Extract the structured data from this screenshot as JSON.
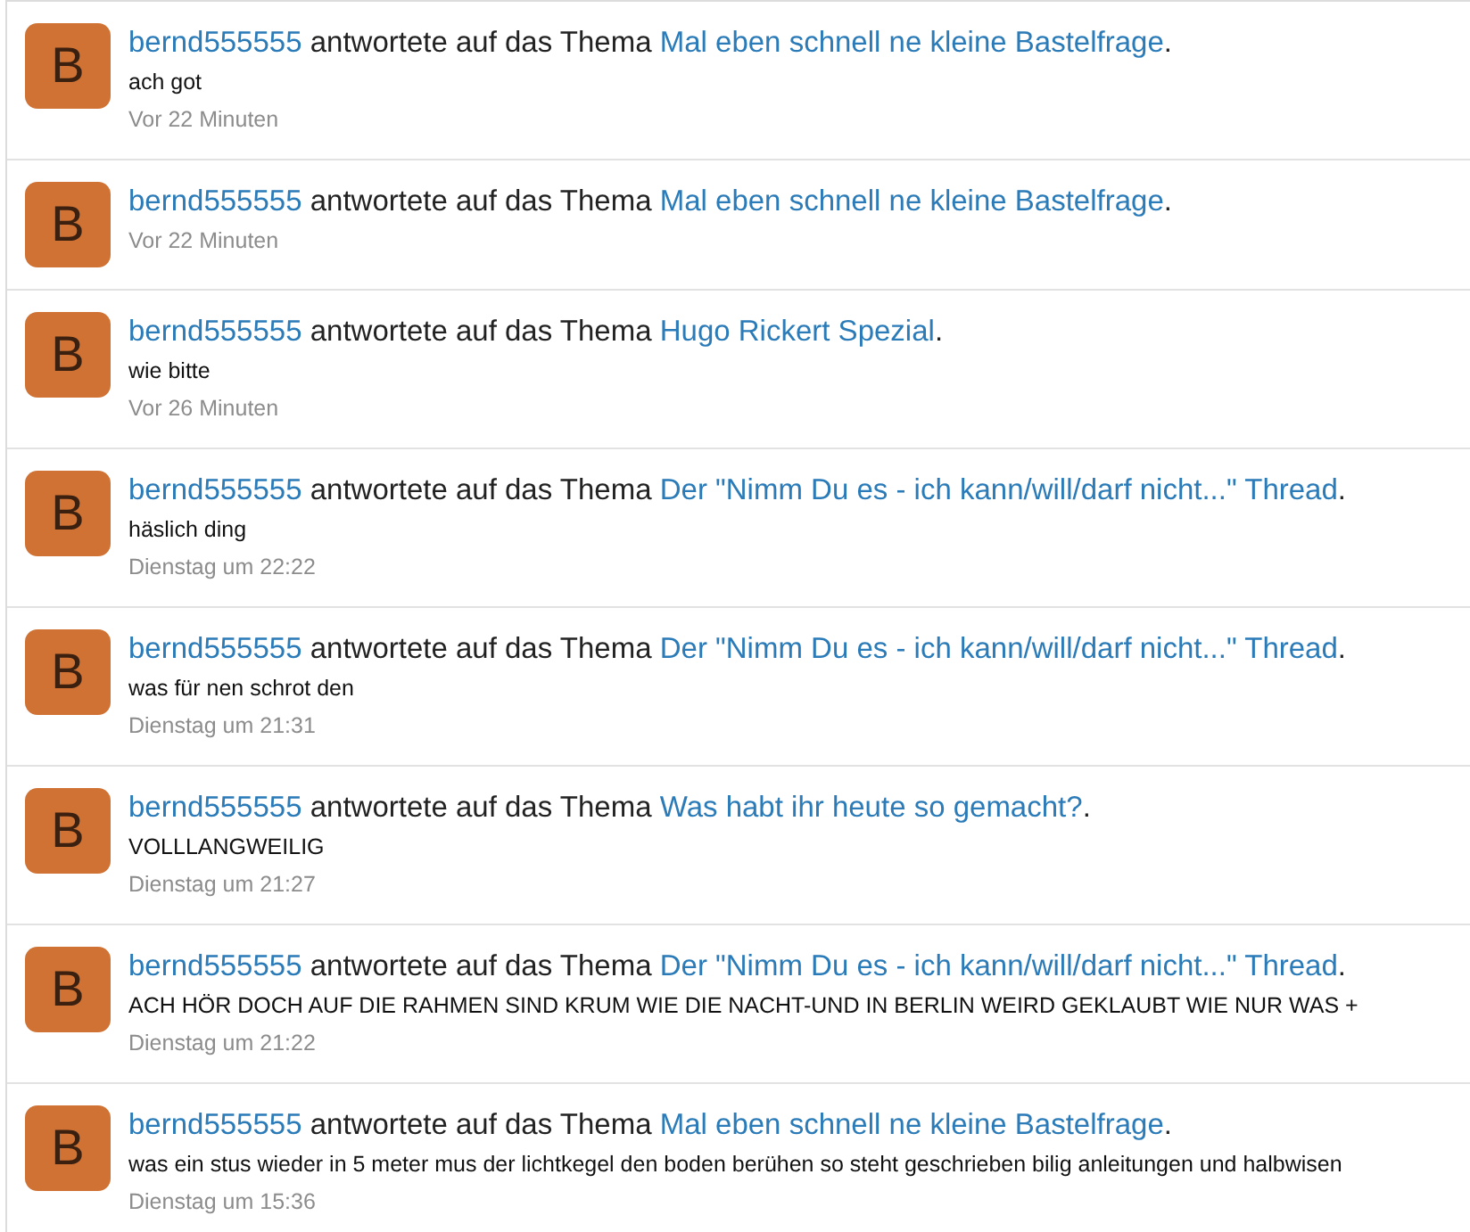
{
  "activity": [
    {
      "avatar_letter": "B",
      "user": "bernd555555",
      "action": "antwortete auf das Thema",
      "thread": "Mal eben schnell ne kleine Bastelfrage",
      "end": ".",
      "message": "ach got",
      "time": "Vor 22 Minuten"
    },
    {
      "avatar_letter": "B",
      "user": "bernd555555",
      "action": "antwortete auf das Thema",
      "thread": "Mal eben schnell ne kleine Bastelfrage",
      "end": ".",
      "time": "Vor 22 Minuten"
    },
    {
      "avatar_letter": "B",
      "user": "bernd555555",
      "action": "antwortete auf das Thema",
      "thread": "Hugo Rickert Spezial",
      "end": ".",
      "message": "wie bitte",
      "time": "Vor 26 Minuten"
    },
    {
      "avatar_letter": "B",
      "user": "bernd555555",
      "action": "antwortete auf das Thema",
      "thread": "Der \"Nimm Du es - ich kann/will/darf nicht...\" Thread",
      "end": ".",
      "message": "häslich ding",
      "time": "Dienstag um 22:22"
    },
    {
      "avatar_letter": "B",
      "user": "bernd555555",
      "action": "antwortete auf das Thema",
      "thread": "Der \"Nimm Du es - ich kann/will/darf nicht...\" Thread",
      "end": ".",
      "message": "was für nen schrot den",
      "time": "Dienstag um 21:31"
    },
    {
      "avatar_letter": "B",
      "user": "bernd555555",
      "action": "antwortete auf das Thema",
      "thread": "Was habt ihr heute so gemacht?",
      "end": ".",
      "message": "VOLLLANGWEILIG",
      "time": "Dienstag um 21:27"
    },
    {
      "avatar_letter": "B",
      "user": "bernd555555",
      "action": "antwortete auf das Thema",
      "thread": "Der \"Nimm Du es - ich kann/will/darf nicht...\" Thread",
      "end": ".",
      "message": "ACH HÖR DOCH AUF DIE RAHMEN SIND KRUM WIE DIE NACHT-UND IN BERLIN WEIRD GEKLAUBT WIE NUR WAS +",
      "time": "Dienstag um 21:22"
    },
    {
      "avatar_letter": "B",
      "user": "bernd555555",
      "action": "antwortete auf das Thema",
      "thread": "Mal eben schnell ne kleine Bastelfrage",
      "end": ".",
      "message": "was ein stus wieder in 5 meter mus der lichtkegel den boden berühen so steht geschrieben bilig anleitungen und halbwisen",
      "time": "Dienstag um 15:36"
    }
  ]
}
